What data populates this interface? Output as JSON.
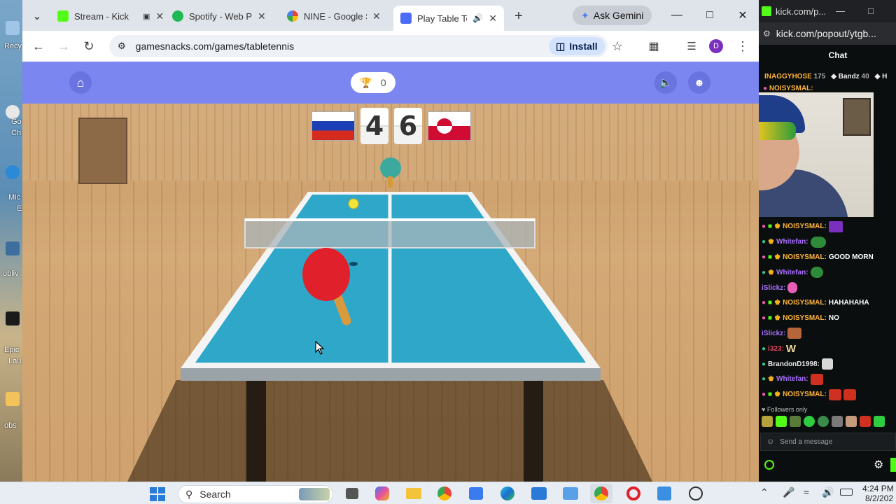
{
  "desktop": {
    "labels": [
      "Recy",
      "Go",
      "Ch",
      "Mic",
      "E",
      "obliv",
      "Epic",
      "Lau",
      "obs"
    ]
  },
  "tabs": [
    {
      "title": "Stream - Kick",
      "color": "#53fc18"
    },
    {
      "title": "Spotify - Web Pla",
      "color": "#1db954"
    },
    {
      "title": "NINE - Google S",
      "color": "#4285f4"
    },
    {
      "title": "Play Table Te",
      "color": "#4a6cf7"
    }
  ],
  "tabbar": {
    "ask_gemini": "Ask Gemini",
    "new_tab": "+"
  },
  "toolbar": {
    "url": "gamesnacks.com/games/tabletennis",
    "install_label": "Install",
    "profile_initial": "D"
  },
  "game": {
    "trophy_count": "0",
    "score_left": "4",
    "score_right": "6"
  },
  "popout": {
    "url": "kick.com/popout/ytgb...",
    "title_bar": "kick.com/p...",
    "chat_title": "Chat",
    "top_users": [
      {
        "name": "INAGGYHOSE",
        "count": "175"
      },
      {
        "name": "Bandz",
        "count": "40"
      },
      {
        "name": "H",
        "count": ""
      }
    ],
    "messages": [
      {
        "user": "NOISYSMAL:",
        "text": "",
        "color": "#ffb43a",
        "emote": "#7b2fbe"
      },
      {
        "user": "Whitefan:",
        "text": "",
        "color": "#a970ff",
        "emote": "#2e8b3a"
      },
      {
        "user": "NOISYSMAL:",
        "text": "GOOD MORN",
        "color": "#ffb43a",
        "emote": ""
      },
      {
        "user": "Whitefan:",
        "text": "",
        "color": "#a970ff",
        "emote": "#2e8b3a"
      },
      {
        "user": "iSlickz:",
        "text": "",
        "color": "#a970ff",
        "emote": "#e85db5"
      },
      {
        "user": "NOISYSMAL:",
        "text": "HAHAHAHA",
        "color": "#ffb43a",
        "emote": ""
      },
      {
        "user": "NOISYSMAL:",
        "text": "NO",
        "color": "#ffb43a",
        "emote": ""
      },
      {
        "user": "iSlickz:",
        "text": "",
        "color": "#a970ff",
        "emote": "#b5653a"
      },
      {
        "user": "i323:",
        "text": "W",
        "color": "#e0455a",
        "emote": ""
      },
      {
        "user": "BrandonD1998:",
        "text": "",
        "color": "#e8e8e8",
        "emote": "#d8d8d8"
      },
      {
        "user": "Whitefan:",
        "text": "",
        "color": "#a970ff",
        "emote": "#d0301f"
      },
      {
        "user": "NOISYSMAL:",
        "text": "",
        "color": "#ffb43a",
        "emote": "#d0301f"
      }
    ],
    "followers_only": "Followers only",
    "send_placeholder": "Send a message"
  },
  "taskbar": {
    "search_label": "Search",
    "time": "4:24 PM",
    "date": "8/2/202"
  }
}
